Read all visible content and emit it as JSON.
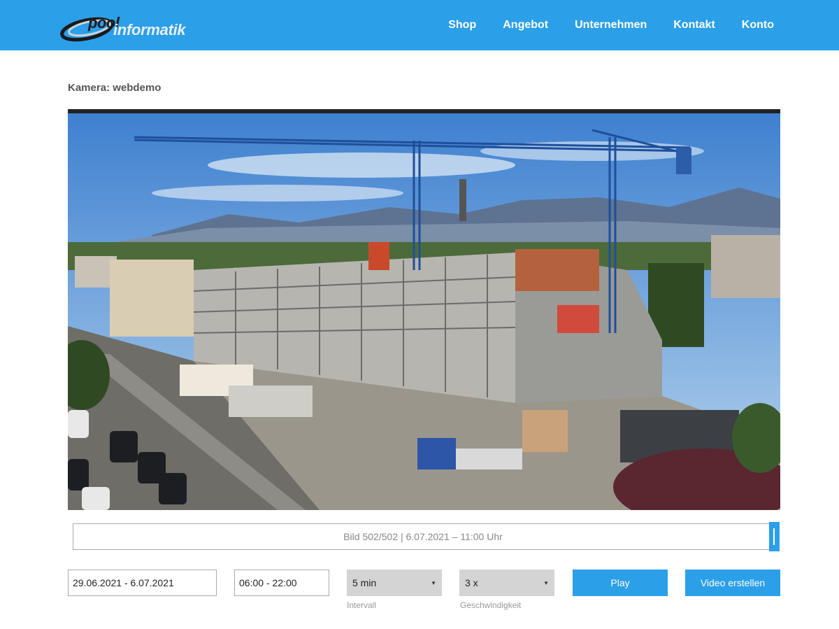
{
  "header": {
    "logo_word1": "pool",
    "logo_word2": "informatik",
    "nav": [
      "Shop",
      "Angebot",
      "Unternehmen",
      "Kontakt",
      "Konto"
    ]
  },
  "camera": {
    "title": "Kamera: webdemo",
    "image_alt": "Webcam-Bild Baustelle"
  },
  "timeline": {
    "label": "Bild 502/502 | 6.07.2021 – 11:00 Uhr",
    "position": 1.0
  },
  "controls": {
    "date_range": "29.06.2021 - 6.07.2021",
    "time_range": "06:00 - 22:00",
    "interval_value": "5 min",
    "interval_label": "Intervall",
    "speed_value": "3 x",
    "speed_label": "Geschwindigkeit",
    "play_label": "Play",
    "video_label": "Video erstellen"
  },
  "colors": {
    "accent": "#2b9fe8",
    "select_bg": "#d4d4d4"
  }
}
